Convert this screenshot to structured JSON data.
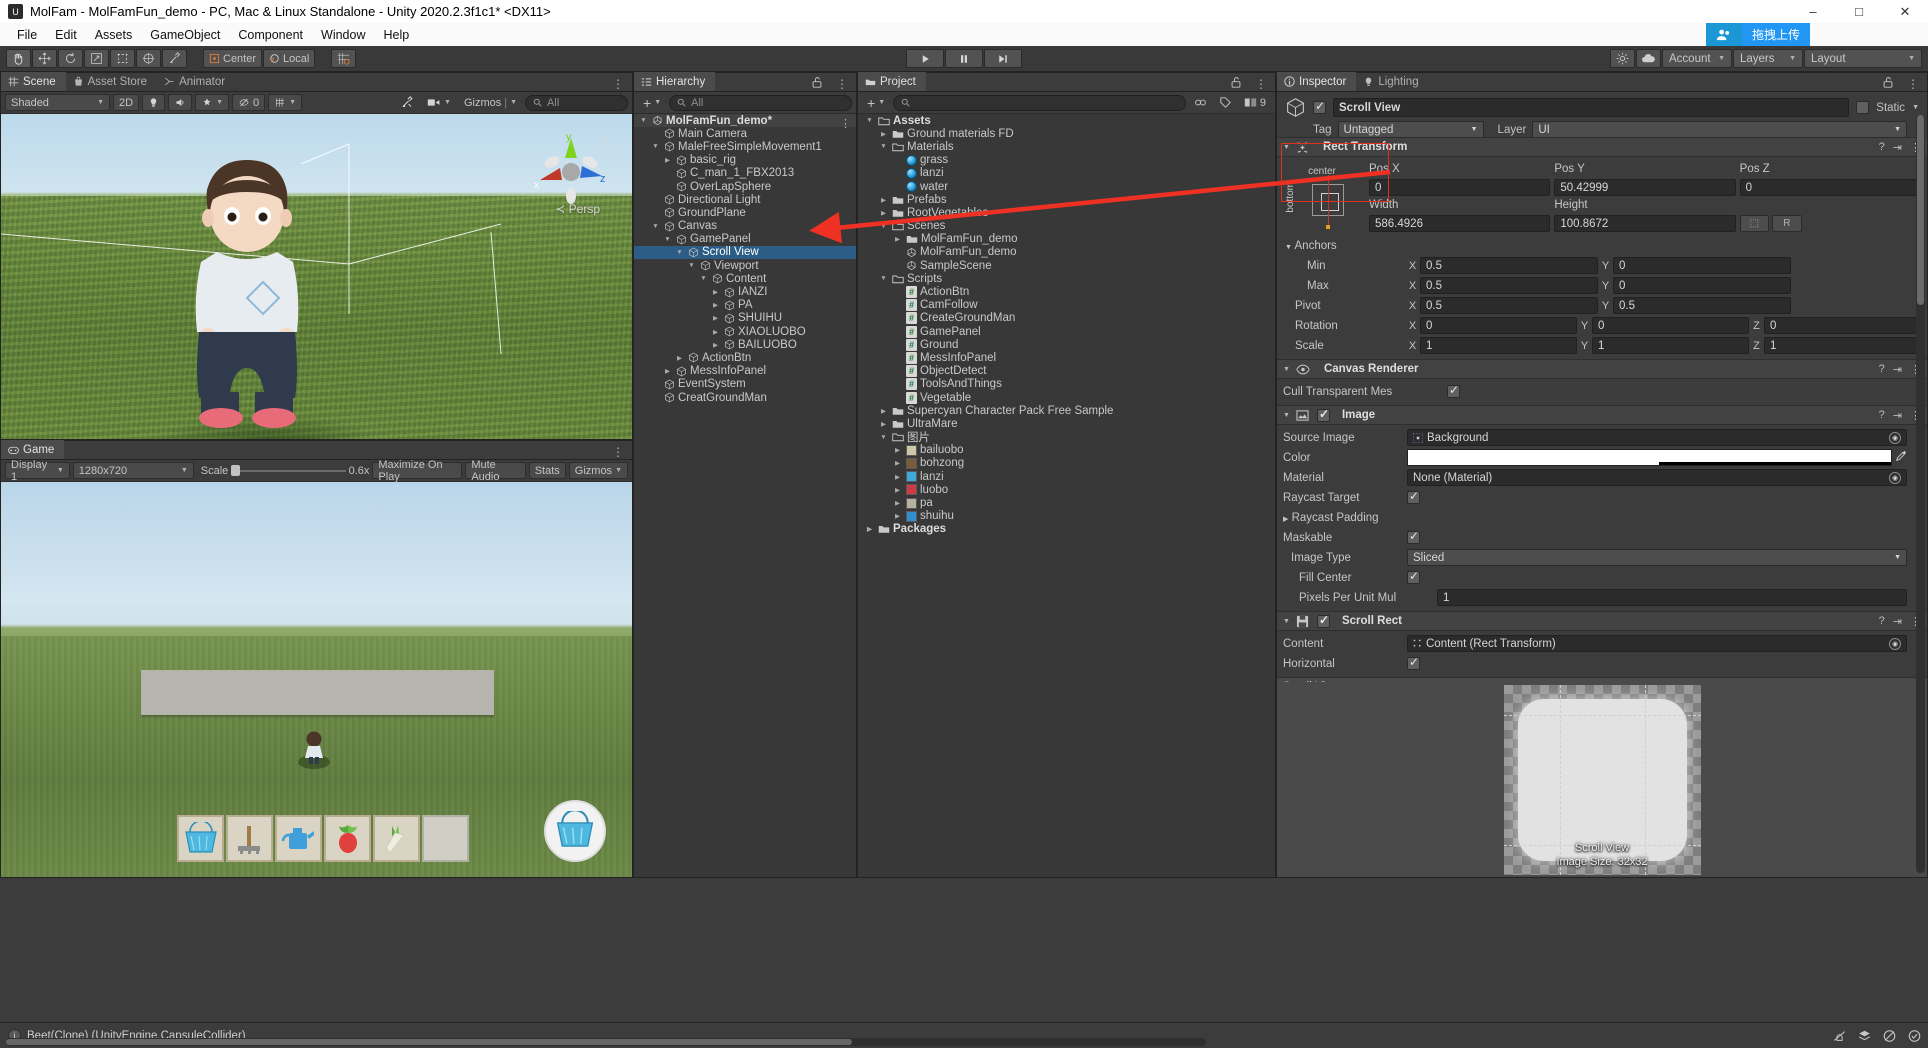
{
  "window": {
    "title": "MolFam - MolFamFun_demo - PC, Mac & Linux Standalone - Unity 2020.2.3f1c1* <DX11>",
    "app_icon": "unity-icon",
    "minimize": "–",
    "maximize": "□",
    "close": "✕"
  },
  "menubar": {
    "items": [
      "File",
      "Edit",
      "Assets",
      "GameObject",
      "Component",
      "Window",
      "Help"
    ]
  },
  "toolbar": {
    "tools": [
      "hand-tool",
      "move-tool",
      "rotate-tool",
      "scale-tool",
      "rect-tool",
      "transform-tool",
      "custom-tool"
    ],
    "pivot_mode": "Center",
    "pivot_rotation": "Local",
    "grid_snap": "grid-icon",
    "play": "▶",
    "pause": "‖",
    "step": "▶|",
    "cloud": "cloud-icon",
    "settings": "settings-icon",
    "account": "Account",
    "layers": "Layers",
    "layout": "Layout",
    "collab_badge": "拖拽上传"
  },
  "scene": {
    "tabs": [
      {
        "label": "Scene",
        "icon": "scene-icon",
        "active": true
      },
      {
        "label": "Asset Store",
        "icon": "store-icon",
        "active": false
      },
      {
        "label": "Animator",
        "icon": "animator-icon",
        "active": false
      }
    ],
    "draw_mode": "Shaded",
    "mode_2d": "2D",
    "lighting_toggle": "light-icon",
    "audio_toggle": "audio-icon",
    "fx_toggle": "fx-icon",
    "hidden_count": "0",
    "grid_icon": "grid-visibility-icon",
    "tools_icon": "scene-tools-icon",
    "camera_icon": "scene-camera-icon",
    "gizmos": "Gizmos",
    "search_placeholder": "All",
    "perspective_label": "Persp",
    "axis_x": "x",
    "axis_y": "y",
    "axis_z": "z"
  },
  "game": {
    "tab": "Game",
    "display": "Display 1",
    "resolution": "1280x720",
    "scale_label": "Scale",
    "scale_value": "0.6x",
    "maximize_on_play": "Maximize On Play",
    "mute_audio": "Mute Audio",
    "stats": "Stats",
    "gizmos": "Gizmos",
    "item_slots": [
      "basket-item",
      "rake-item",
      "wateringcan-item",
      "radish-item",
      "carrot-item",
      "empty-slot"
    ],
    "basket_button": "basket-button"
  },
  "hierarchy": {
    "tab": "Hierarchy",
    "add_button": "+",
    "search_placeholder": "All",
    "items": [
      {
        "label": "MolFamFun_demo*",
        "depth": 0,
        "arrow": "down",
        "icon": "scene-icon",
        "root": true
      },
      {
        "label": "Main Camera",
        "depth": 1,
        "arrow": "none",
        "icon": "gameobject-icon"
      },
      {
        "label": "MaleFreeSimpleMovement1",
        "depth": 1,
        "arrow": "down",
        "icon": "gameobject-icon"
      },
      {
        "label": "basic_rig",
        "depth": 2,
        "arrow": "right",
        "icon": "gameobject-icon"
      },
      {
        "label": "C_man_1_FBX2013",
        "depth": 2,
        "arrow": "none",
        "icon": "gameobject-icon"
      },
      {
        "label": "OverLapSphere",
        "depth": 2,
        "arrow": "none",
        "icon": "gameobject-icon"
      },
      {
        "label": "Directional Light",
        "depth": 1,
        "arrow": "none",
        "icon": "gameobject-icon"
      },
      {
        "label": "GroundPlane",
        "depth": 1,
        "arrow": "none",
        "icon": "gameobject-icon"
      },
      {
        "label": "Canvas",
        "depth": 1,
        "arrow": "down",
        "icon": "gameobject-icon"
      },
      {
        "label": "GamePanel",
        "depth": 2,
        "arrow": "down",
        "icon": "gameobject-icon"
      },
      {
        "label": "Scroll View",
        "depth": 3,
        "arrow": "down",
        "icon": "gameobject-icon",
        "selected": true
      },
      {
        "label": "Viewport",
        "depth": 4,
        "arrow": "down",
        "icon": "gameobject-icon"
      },
      {
        "label": "Content",
        "depth": 5,
        "arrow": "down",
        "icon": "gameobject-icon"
      },
      {
        "label": "IANZI",
        "depth": 6,
        "arrow": "right",
        "icon": "gameobject-icon"
      },
      {
        "label": "PA",
        "depth": 6,
        "arrow": "right",
        "icon": "gameobject-icon"
      },
      {
        "label": "SHUIHU",
        "depth": 6,
        "arrow": "right",
        "icon": "gameobject-icon"
      },
      {
        "label": "XIAOLUOBO",
        "depth": 6,
        "arrow": "right",
        "icon": "gameobject-icon"
      },
      {
        "label": "BAILUOBO",
        "depth": 6,
        "arrow": "right",
        "icon": "gameobject-icon"
      },
      {
        "label": "ActionBtn",
        "depth": 3,
        "arrow": "right",
        "icon": "gameobject-icon"
      },
      {
        "label": "MessInfoPanel",
        "depth": 2,
        "arrow": "right",
        "icon": "gameobject-icon"
      },
      {
        "label": "EventSystem",
        "depth": 1,
        "arrow": "none",
        "icon": "gameobject-icon"
      },
      {
        "label": "CreatGroundMan",
        "depth": 1,
        "arrow": "none",
        "icon": "gameobject-icon"
      }
    ]
  },
  "project": {
    "tab": "Project",
    "add_button": "+",
    "search_placeholder": "",
    "items": [
      {
        "label": "Assets",
        "depth": 0,
        "arrow": "down",
        "icon": "folder-open-icon",
        "bold": true
      },
      {
        "label": "Ground materials FD",
        "depth": 1,
        "arrow": "right",
        "icon": "folder-icon"
      },
      {
        "label": "Materials",
        "depth": 1,
        "arrow": "down",
        "icon": "folder-open-icon"
      },
      {
        "label": "grass",
        "depth": 2,
        "arrow": "none",
        "icon": "material-icon"
      },
      {
        "label": "lanzi",
        "depth": 2,
        "arrow": "none",
        "icon": "material-icon"
      },
      {
        "label": "water",
        "depth": 2,
        "arrow": "none",
        "icon": "material-icon"
      },
      {
        "label": "Prefabs",
        "depth": 1,
        "arrow": "right",
        "icon": "folder-icon"
      },
      {
        "label": "RootVegetables",
        "depth": 1,
        "arrow": "right",
        "icon": "folder-icon"
      },
      {
        "label": "Scenes",
        "depth": 1,
        "arrow": "down",
        "icon": "folder-open-icon"
      },
      {
        "label": "MolFamFun_demo",
        "depth": 2,
        "arrow": "right",
        "icon": "folder-icon"
      },
      {
        "label": "MolFamFun_demo",
        "depth": 2,
        "arrow": "none",
        "icon": "unity-scene-icon"
      },
      {
        "label": "SampleScene",
        "depth": 2,
        "arrow": "none",
        "icon": "unity-scene-icon"
      },
      {
        "label": "Scripts",
        "depth": 1,
        "arrow": "down",
        "icon": "folder-open-icon"
      },
      {
        "label": "ActionBtn",
        "depth": 2,
        "arrow": "none",
        "icon": "cs-script-icon"
      },
      {
        "label": "CamFollow",
        "depth": 2,
        "arrow": "none",
        "icon": "cs-script-icon"
      },
      {
        "label": "CreateGroundMan",
        "depth": 2,
        "arrow": "none",
        "icon": "cs-script-icon"
      },
      {
        "label": "GamePanel",
        "depth": 2,
        "arrow": "none",
        "icon": "cs-script-icon"
      },
      {
        "label": "Ground",
        "depth": 2,
        "arrow": "none",
        "icon": "cs-script-icon"
      },
      {
        "label": "MessInfoPanel",
        "depth": 2,
        "arrow": "none",
        "icon": "cs-script-icon"
      },
      {
        "label": "ObjectDetect",
        "depth": 2,
        "arrow": "none",
        "icon": "cs-script-icon"
      },
      {
        "label": "ToolsAndThings",
        "depth": 2,
        "arrow": "none",
        "icon": "cs-script-icon"
      },
      {
        "label": "Vegetable",
        "depth": 2,
        "arrow": "none",
        "icon": "cs-script-icon"
      },
      {
        "label": "Supercyan Character Pack Free Sample",
        "depth": 1,
        "arrow": "right",
        "icon": "folder-icon"
      },
      {
        "label": "UltraMare",
        "depth": 1,
        "arrow": "right",
        "icon": "folder-icon"
      },
      {
        "label": "图片",
        "depth": 1,
        "arrow": "down",
        "icon": "folder-open-icon"
      },
      {
        "label": "bailuobo",
        "depth": 2,
        "arrow": "right",
        "icon": "texture-icon",
        "color": "#cfc8a8"
      },
      {
        "label": "bohzong",
        "depth": 2,
        "arrow": "right",
        "icon": "texture-icon",
        "color": "#7a5b3c"
      },
      {
        "label": "lanzi",
        "depth": 2,
        "arrow": "right",
        "icon": "texture-icon",
        "color": "#3fa8d8"
      },
      {
        "label": "luobo",
        "depth": 2,
        "arrow": "right",
        "icon": "texture-icon",
        "color": "#cf3b44"
      },
      {
        "label": "pa",
        "depth": 2,
        "arrow": "right",
        "icon": "texture-icon",
        "color": "#b8b0a0"
      },
      {
        "label": "shuihu",
        "depth": 2,
        "arrow": "right",
        "icon": "texture-icon",
        "color": "#2f8fd0"
      },
      {
        "label": "Packages",
        "depth": 0,
        "arrow": "right",
        "icon": "folder-icon",
        "bold": true
      }
    ]
  },
  "inspector": {
    "tabs": [
      {
        "label": "Inspector",
        "icon": "info-icon",
        "active": true
      },
      {
        "label": "Lighting",
        "icon": "lighting-icon",
        "active": false
      }
    ],
    "lock_icon": "lock-open-icon",
    "menu_icon": "kebab-icon",
    "object_name": "Scroll View",
    "active_checked": true,
    "static_label": "Static",
    "static_checked": false,
    "tag_label": "Tag",
    "tag_value": "Untagged",
    "layer_label": "Layer",
    "layer_value": "UI",
    "rect_transform": {
      "title": "Rect Transform",
      "anchor_preset_top": "center",
      "anchor_preset_left": "bottom",
      "pos_x_label": "Pos X",
      "pos_x": "0",
      "pos_y_label": "Pos Y",
      "pos_y": "50.42999",
      "pos_z_label": "Pos Z",
      "pos_z": "0",
      "width_label": "Width",
      "width": "586.4926",
      "height_label": "Height",
      "height": "100.8672",
      "blueprint_btn": "blueprint-mode-icon",
      "raw_btn": "R",
      "anchors_label": "Anchors",
      "min_label": "Min",
      "min_x": "0.5",
      "min_y": "0",
      "max_label": "Max",
      "max_x": "0.5",
      "max_y": "0",
      "pivot_label": "Pivot",
      "pivot_x": "0.5",
      "pivot_y": "0.5",
      "rotation_label": "Rotation",
      "rot_x": "0",
      "rot_y": "0",
      "rot_z": "0",
      "scale_label": "Scale",
      "scale_x": "1",
      "scale_y": "1",
      "scale_z": "1"
    },
    "canvas_renderer": {
      "title": "Canvas Renderer",
      "cull_label": "Cull Transparent Mes",
      "cull_checked": true
    },
    "image": {
      "title": "Image",
      "enabled": true,
      "source_image_label": "Source Image",
      "source_image_value": "Background",
      "color_label": "Color",
      "color_value": "#FFFFFF",
      "material_label": "Material",
      "material_value": "None (Material)",
      "raycast_target_label": "Raycast Target",
      "raycast_target_checked": true,
      "raycast_padding_label": "Raycast Padding",
      "maskable_label": "Maskable",
      "maskable_checked": true,
      "image_type_label": "Image Type",
      "image_type_value": "Sliced",
      "fill_center_label": "Fill Center",
      "fill_center_checked": true,
      "ppu_label": "Pixels Per Unit Mul",
      "ppu_value": "1"
    },
    "scroll_rect": {
      "title": "Scroll Rect",
      "enabled": true,
      "content_label": "Content",
      "content_value": "Content (Rect Transform)",
      "horizontal_label": "Horizontal",
      "horizontal_checked": true
    },
    "preview": {
      "header": "Scroll View",
      "name": "Scroll View",
      "image_size": "Image Size: 32x32"
    }
  },
  "statusbar": {
    "message": "Beet(Clone) (UnityEngine.CapsuleCollider)",
    "icon": "console-info-icon"
  }
}
